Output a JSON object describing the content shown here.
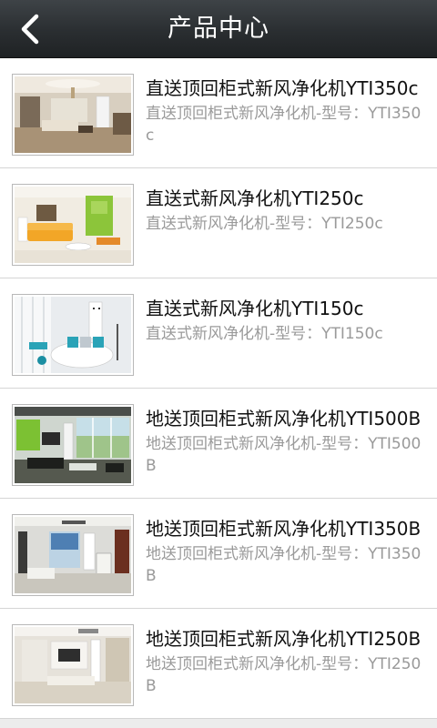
{
  "header": {
    "title": "产品中心",
    "back_icon": "chevron-left-icon"
  },
  "products": [
    {
      "name": "直送顶回柜式新风净化机YTI350c",
      "desc": "直送顶回柜式新风净化机-型号：YTI350c"
    },
    {
      "name": "直送式新风净化机YTI250c",
      "desc": "直送式新风净化机-型号：YTI250c"
    },
    {
      "name": "直送式新风净化机YTI150c",
      "desc": "直送式新风净化机-型号：YTI150c"
    },
    {
      "name": "地送顶回柜式新风净化机YTI500B",
      "desc": "地送顶回柜式新风净化机-型号：YTI500B"
    },
    {
      "name": "地送顶回柜式新风净化机YTI350B",
      "desc": "地送顶回柜式新风净化机-型号：YTI350B"
    },
    {
      "name": "地送顶回柜式新风净化机YTI250B",
      "desc": "地送顶回柜式新风净化机-型号：YTI250B"
    }
  ]
}
